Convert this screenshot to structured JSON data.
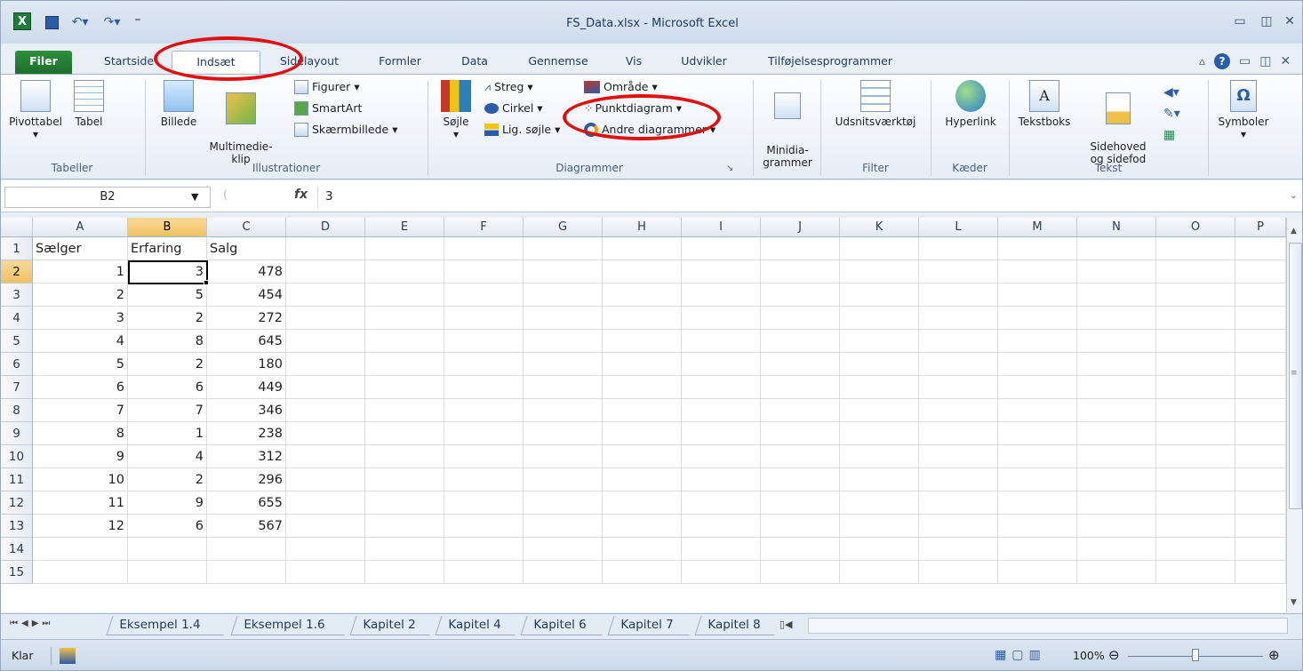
{
  "window": {
    "title": "FS_Data.xlsx - Microsoft Excel"
  },
  "quick_access": {
    "save_icon": "save-icon",
    "undo_icon": "undo-icon",
    "redo_icon": "redo-icon"
  },
  "tabs": [
    {
      "label": "Filer"
    },
    {
      "label": "Startside"
    },
    {
      "label": "Indsæt"
    },
    {
      "label": "Sidelayout"
    },
    {
      "label": "Formler"
    },
    {
      "label": "Data"
    },
    {
      "label": "Gennemse"
    },
    {
      "label": "Vis"
    },
    {
      "label": "Udvikler"
    },
    {
      "label": "Tilføjelsesprogrammer"
    }
  ],
  "ribbon": {
    "tabeller": {
      "label": "Tabeller",
      "pivot": "Pivottabel",
      "tabel": "Tabel"
    },
    "illustrationer": {
      "label": "Illustrationer",
      "billede": "Billede",
      "multimedie": "Multimedie-\nklip",
      "figurer": "Figurer",
      "smartart": "SmartArt",
      "skaermbillede": "Skærmbillede"
    },
    "diagrammer": {
      "label": "Diagrammer",
      "soejle": "Søjle",
      "streg": "Streg",
      "cirkel": "Cirkel",
      "ligsoejle": "Lig. søjle",
      "omraade": "Område",
      "punkt": "Punktdiagram",
      "andre": "Andre diagrammer"
    },
    "minidia": {
      "label": "Minidia-\ngrammer"
    },
    "filter": {
      "label": "Filter",
      "udsnit": "Udsnitsværktøj"
    },
    "kaeder": {
      "label": "Kæder",
      "hyperlink": "Hyperlink"
    },
    "tekst": {
      "label": "Tekst",
      "tekstboks": "Tekstboks",
      "sidehoved": "Sidehoved\nog sidefod"
    },
    "symboler": {
      "label": "Symboler"
    }
  },
  "formula_bar": {
    "namebox": "B2",
    "fx": "fx",
    "value": "3"
  },
  "columns": [
    "A",
    "B",
    "C",
    "D",
    "E",
    "F",
    "G",
    "H",
    "I",
    "J",
    "K",
    "L",
    "M",
    "N",
    "O",
    "P"
  ],
  "rows": [
    {
      "n": "1",
      "a": "Sælger",
      "b": "Erfaring",
      "c": "Salg"
    },
    {
      "n": "2",
      "a": "1",
      "b": "3",
      "c": "478"
    },
    {
      "n": "3",
      "a": "2",
      "b": "5",
      "c": "454"
    },
    {
      "n": "4",
      "a": "3",
      "b": "2",
      "c": "272"
    },
    {
      "n": "5",
      "a": "4",
      "b": "8",
      "c": "645"
    },
    {
      "n": "6",
      "a": "5",
      "b": "2",
      "c": "180"
    },
    {
      "n": "7",
      "a": "6",
      "b": "6",
      "c": "449"
    },
    {
      "n": "8",
      "a": "7",
      "b": "7",
      "c": "346"
    },
    {
      "n": "9",
      "a": "8",
      "b": "1",
      "c": "238"
    },
    {
      "n": "10",
      "a": "9",
      "b": "4",
      "c": "312"
    },
    {
      "n": "11",
      "a": "10",
      "b": "2",
      "c": "296"
    },
    {
      "n": "12",
      "a": "11",
      "b": "9",
      "c": "655"
    },
    {
      "n": "13",
      "a": "12",
      "b": "6",
      "c": "567"
    },
    {
      "n": "14",
      "a": "",
      "b": "",
      "c": ""
    },
    {
      "n": "15",
      "a": "",
      "b": "",
      "c": ""
    }
  ],
  "sheets": [
    "Eksempel 1.4",
    "Eksempel 1.6",
    "Kapitel 2",
    "Kapitel 4",
    "Kapitel 6",
    "Kapitel 7",
    "Kapitel 8"
  ],
  "status": {
    "ready": "Klar",
    "zoom": "100%"
  },
  "colors": {
    "highlight": "#e01010",
    "accent": "#1d6e2c"
  }
}
